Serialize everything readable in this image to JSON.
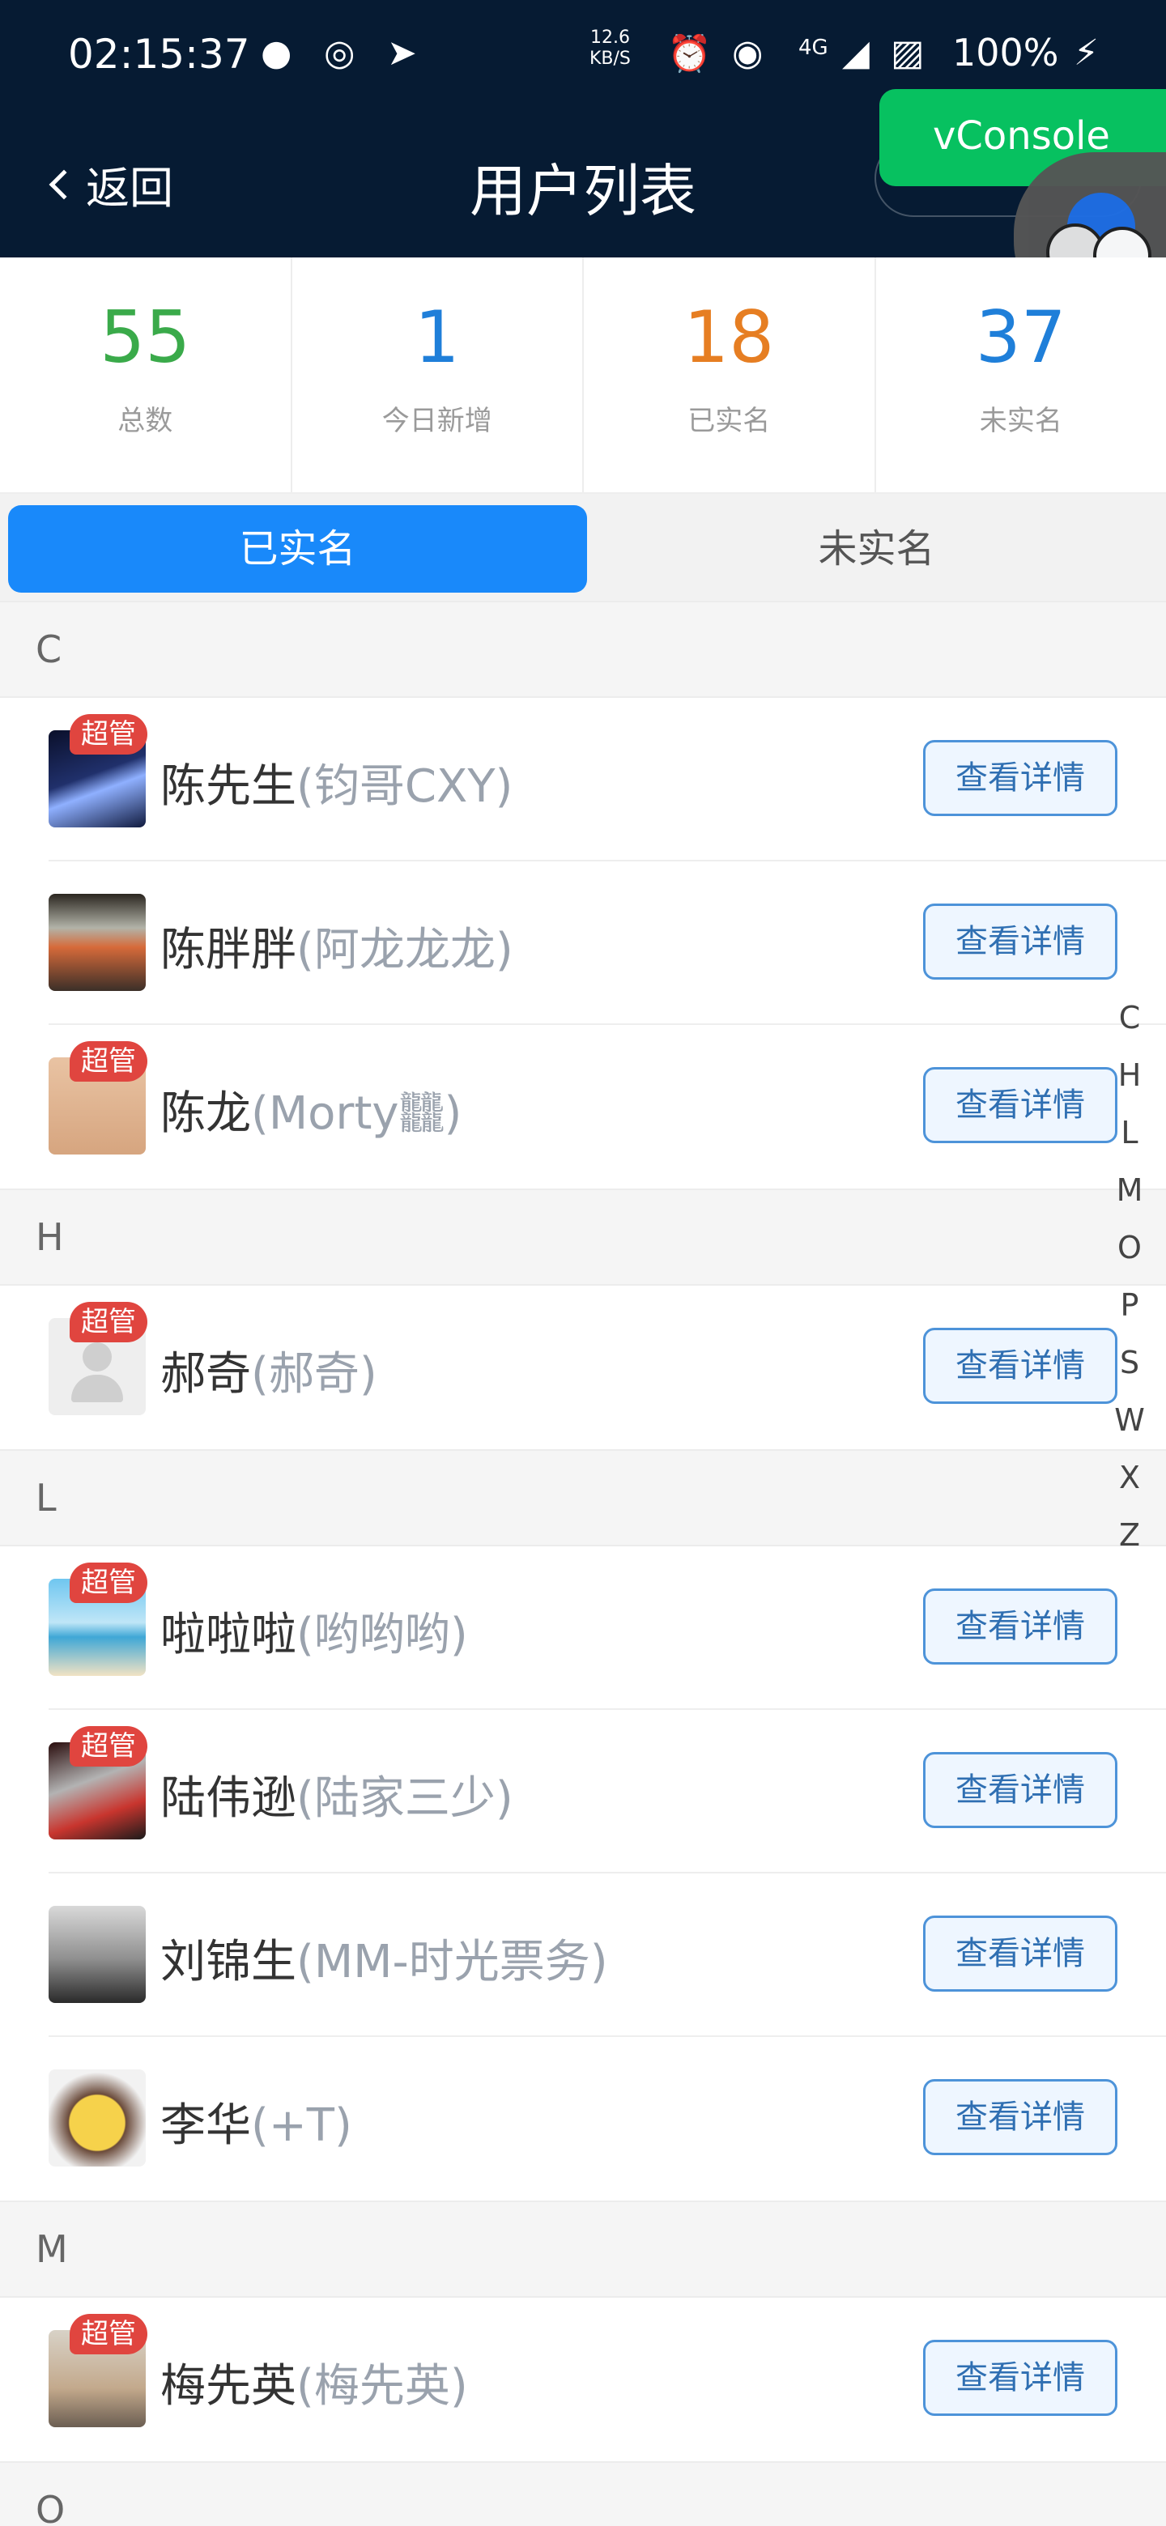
{
  "status_bar": {
    "time": "02:15:37",
    "speed_value": "12.6",
    "speed_unit": "KB/S",
    "network": "4G",
    "battery": "100%",
    "icons": [
      "wechat-ball-icon",
      "instagram-icon",
      "telegram-icon",
      "alarm-icon",
      "hotspot-icon",
      "signal-icon",
      "no-sim-icon",
      "charging-icon"
    ]
  },
  "nav": {
    "back_label": "返回",
    "title": "用户列表",
    "capsule_dots": "•••"
  },
  "vconsole": {
    "label": "vConsole"
  },
  "stats": [
    {
      "value": "55",
      "label": "总数",
      "color": "#3aaa4a"
    },
    {
      "value": "1",
      "label": "今日新增",
      "color": "#1f7fd9"
    },
    {
      "value": "18",
      "label": "已实名",
      "color": "#e67e22"
    },
    {
      "value": "37",
      "label": "未实名",
      "color": "#1f7fd9"
    }
  ],
  "tabs": [
    {
      "label": "已实名",
      "active": true
    },
    {
      "label": "未实名",
      "active": false
    }
  ],
  "badge_label": "超管",
  "detail_label": "查看详情",
  "sections": [
    {
      "letter": "C",
      "users": [
        {
          "name": "陈先生",
          "nick": "(钧哥CXY)",
          "admin": true
        },
        {
          "name": "陈胖胖",
          "nick": "(阿龙龙龙)",
          "admin": false
        },
        {
          "name": "陈龙",
          "nick": "(Morty𪚥)",
          "admin": true
        }
      ]
    },
    {
      "letter": "H",
      "users": [
        {
          "name": "郝奇",
          "nick": "(郝奇)",
          "admin": true
        }
      ]
    },
    {
      "letter": "L",
      "users": [
        {
          "name": "啦啦啦",
          "nick": "(哟哟哟)",
          "admin": true
        },
        {
          "name": "陆伟逊",
          "nick": "(陆家三少)",
          "admin": true
        },
        {
          "name": "刘锦生",
          "nick": "(MM-时光票务)",
          "admin": false
        },
        {
          "name": "李华",
          "nick": "(+T)",
          "admin": false
        }
      ]
    },
    {
      "letter": "M",
      "users": [
        {
          "name": "梅先英",
          "nick": "(梅先英)",
          "admin": true
        }
      ]
    },
    {
      "letter": "O",
      "users": []
    }
  ],
  "index_letters": [
    "C",
    "H",
    "L",
    "M",
    "O",
    "P",
    "S",
    "W",
    "X",
    "Z"
  ]
}
